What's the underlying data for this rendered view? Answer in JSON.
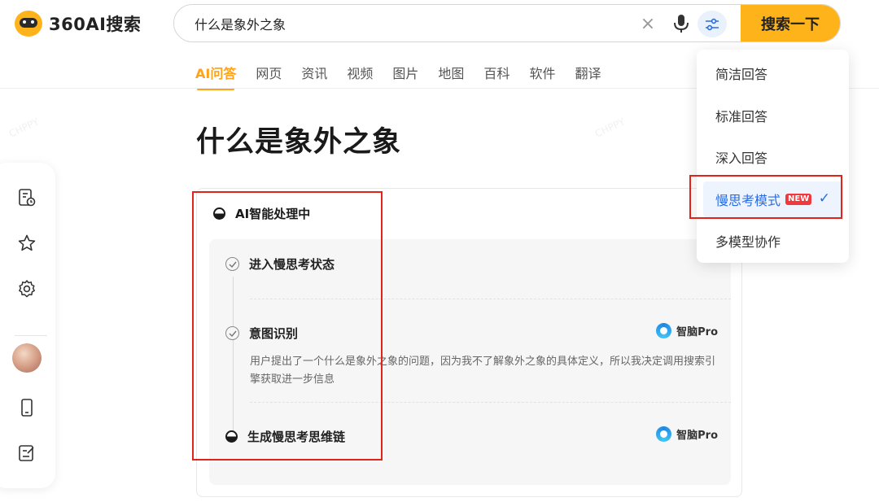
{
  "header": {
    "logo_text": "360AI搜索",
    "search_value": "什么是象外之象",
    "search_button_label": "搜索一下"
  },
  "tabs": [
    {
      "label": "AI问答",
      "active": true
    },
    {
      "label": "网页"
    },
    {
      "label": "资讯"
    },
    {
      "label": "视频"
    },
    {
      "label": "图片"
    },
    {
      "label": "地图"
    },
    {
      "label": "百科"
    },
    {
      "label": "软件"
    },
    {
      "label": "翻译"
    }
  ],
  "page_title": "什么是象外之象",
  "card": {
    "status": "AI智能处理中",
    "steps": [
      {
        "title": "进入慢思考状态",
        "icon": "check-circle-icon"
      },
      {
        "title": "意图识别",
        "icon": "check-circle-icon",
        "model": "智脑Pro",
        "description": "用户提出了一个什么是象外之象的问题，因为我不了解象外之象的具体定义，所以我决定调用搜索引擎获取进一步信息"
      },
      {
        "title": "生成慢思考思维链",
        "icon": "half-circle-icon",
        "model": "智脑Pro"
      }
    ]
  },
  "dropdown": {
    "items": [
      {
        "label": "简洁回答"
      },
      {
        "label": "标准回答"
      },
      {
        "label": "深入回答"
      },
      {
        "label": "慢思考模式",
        "badge": "NEW",
        "selected": true
      },
      {
        "label": "多模型协作"
      }
    ]
  },
  "sidebar": {
    "icons": [
      "history-icon",
      "star-icon",
      "gear-icon",
      "avatar",
      "phone-icon",
      "edit-icon"
    ]
  },
  "colors": {
    "brand": "#ffb31a",
    "active_tab": "#ffa31a",
    "selection_blue": "#2a6ce0",
    "annotation_red": "#e2231a"
  }
}
